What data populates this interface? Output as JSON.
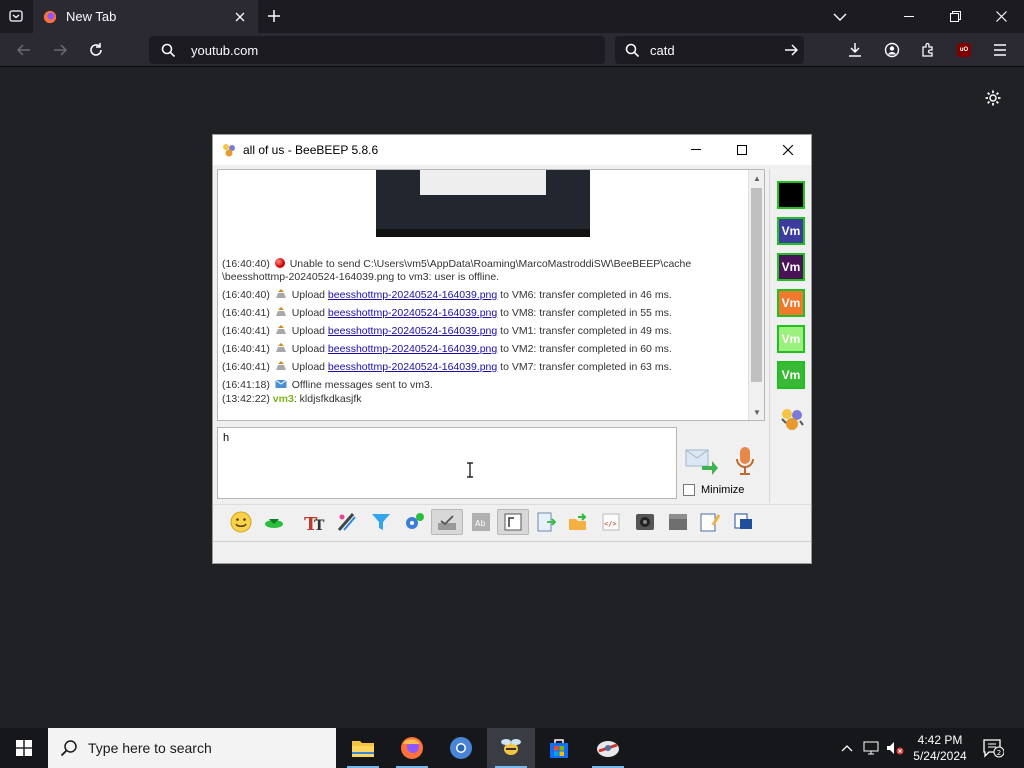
{
  "browser": {
    "tab_title": "New Tab",
    "url": "youtub.com",
    "search_query": "catd"
  },
  "beebeep": {
    "window_title": "all of us - BeeBEEP 5.8.6",
    "messages": [
      {
        "time": "(16:40:40)",
        "text": "Unable to send C:\\Users\\vm5\\AppData\\Roaming\\MarcoMastroddiSW\\BeeBEEP\\cache",
        "text2": "\\beesshottmp-20240524-164039.png to vm3: user is offline."
      },
      {
        "time": "(16:40:40)",
        "pre": "Upload",
        "link": "beesshottmp-20240524-164039.png",
        "post": "to VM6: transfer completed in 46 ms."
      },
      {
        "time": "(16:40:41)",
        "pre": "Upload",
        "link": "beesshottmp-20240524-164039.png",
        "post": "to VM8: transfer completed in 55 ms."
      },
      {
        "time": "(16:40:41)",
        "pre": "Upload",
        "link": "beesshottmp-20240524-164039.png",
        "post": "to VM1: transfer completed in 49 ms."
      },
      {
        "time": "(16:40:41)",
        "pre": "Upload",
        "link": "beesshottmp-20240524-164039.png",
        "post": "to VM2: transfer completed in 60 ms."
      },
      {
        "time": "(16:40:41)",
        "pre": "Upload",
        "link": "beesshottmp-20240524-164039.png",
        "post": "to VM7: transfer completed in 63 ms."
      },
      {
        "time": "(16:41:18)",
        "text": "Offline messages sent to vm3."
      },
      {
        "time": "(13:42:22)",
        "user": "vm3",
        "text": "kldjsfkdkasjfk"
      }
    ],
    "input_text": "h",
    "minimize_label": "Minimize",
    "user_tiles": [
      {
        "label": "",
        "bg": "#000000"
      },
      {
        "label": "Vm",
        "bg": "#3c3c9e"
      },
      {
        "label": "Vm",
        "bg": "#4b1357"
      },
      {
        "label": "Vm",
        "bg": "#ef7a2e"
      },
      {
        "label": "Vm",
        "bg": "#9bf07e"
      },
      {
        "label": "Vm",
        "bg": "#39b935"
      }
    ]
  },
  "taskbar": {
    "search_placeholder": "Type here to search",
    "time": "4:42 PM",
    "date": "5/24/2024",
    "notification_count": "2"
  }
}
